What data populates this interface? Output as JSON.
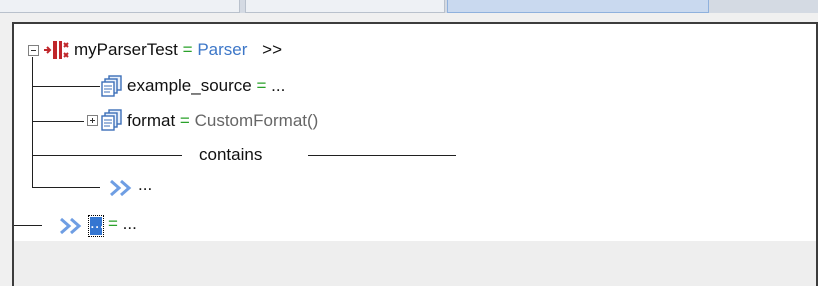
{
  "root": {
    "name": "myParserTest",
    "op": "=",
    "type": "Parser",
    "more": ">>"
  },
  "children": [
    {
      "name": "example_source",
      "op": "=",
      "value": "..."
    },
    {
      "name": "format",
      "op": "=",
      "value": "CustomFormat()"
    }
  ],
  "contains_label": "contains",
  "placeholder_child": {
    "value": "..."
  },
  "bottom_row": {
    "selected": "...",
    "op": "=",
    "value": "..."
  },
  "icons": {
    "expand": "minus-expander-icon",
    "collapse": "plus-expander-icon",
    "root": "red-node-icon",
    "property": "property-sheet-icon",
    "add": "double-chevron-icon"
  },
  "colors": {
    "operator": "#2aa12a",
    "type_link": "#3d77c8",
    "selection": "#3476d1",
    "root_icon": "#c0262b"
  }
}
